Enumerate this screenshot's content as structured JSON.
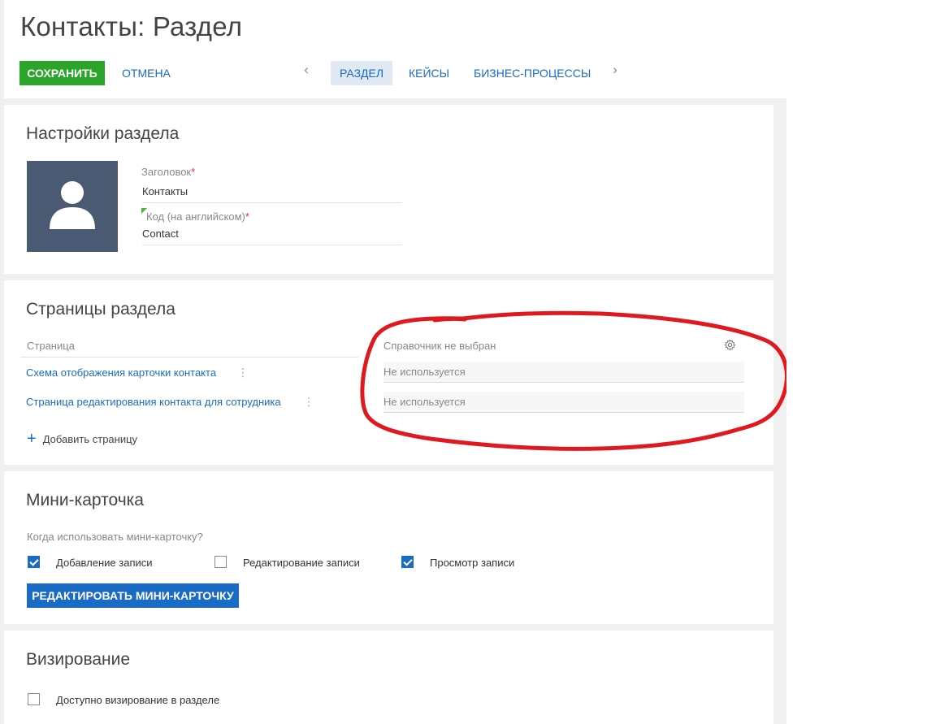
{
  "header": {
    "title": "Контакты: Раздел",
    "save_label": "СОХРАНИТЬ",
    "cancel_label": "ОТМЕНА",
    "tabs": [
      {
        "label": "РАЗДЕЛ",
        "active": true
      },
      {
        "label": "КЕЙСЫ",
        "active": false
      },
      {
        "label": "БИЗНЕС-ПРОЦЕССЫ",
        "active": false
      }
    ],
    "prev_arrow": "‹",
    "next_arrow": "›"
  },
  "section_settings": {
    "title": "Настройки раздела",
    "avatar_icon": "user-silhouette-icon",
    "fields": [
      {
        "label": "Заголовок",
        "required": "*",
        "value": "Контакты"
      },
      {
        "label": "Код (на английском)",
        "required": "*",
        "value": "Contact"
      }
    ]
  },
  "section_pages": {
    "title": "Страницы раздела",
    "col_page": "Страница",
    "col_lookup": "Справочник не выбран",
    "rows": [
      {
        "page": "Схема отображения карточки контакта",
        "lookup": "Не используется"
      },
      {
        "page": "Страница редактирования контакта для сотрудника",
        "lookup": "Не используется"
      }
    ],
    "add_label": "Добавить страницу"
  },
  "mini_card": {
    "title": "Мини-карточка",
    "question": "Когда использовать мини-карточку?",
    "options": [
      {
        "label": "Добавление записи",
        "checked": true
      },
      {
        "label": "Редактирование записи",
        "checked": false
      },
      {
        "label": "Просмотр записи",
        "checked": true
      }
    ],
    "edit_button": "РЕДАКТИРОВАТЬ МИНИ-КАРТОЧКУ"
  },
  "visa": {
    "title": "Визирование",
    "option": {
      "label": "Доступно визирование в разделе",
      "checked": false
    }
  },
  "colors": {
    "save_green": "#2aa52a",
    "link_blue": "#1a6bc4",
    "avatar_bg": "#4b5a73",
    "annotation_red": "#e0191f"
  }
}
